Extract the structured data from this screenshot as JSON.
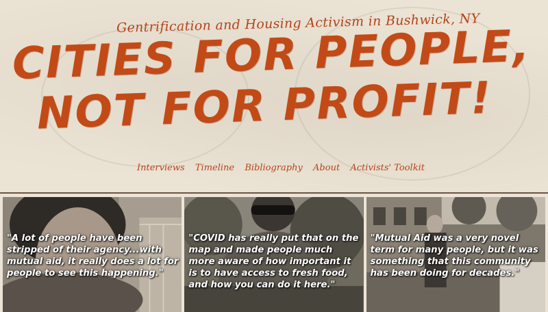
{
  "site": {
    "subtitle": "Gentrification and Housing Activism in Bushwick, NY",
    "headline_line1": "CITIES FOR PEOPLE,",
    "headline_line2": "NOT FOR PROFIT!"
  },
  "nav": {
    "items": [
      {
        "label": "Interviews"
      },
      {
        "label": "Timeline"
      },
      {
        "label": "Bibliography"
      },
      {
        "label": "About"
      },
      {
        "label": "Activists' Toolkit"
      }
    ]
  },
  "quotes": [
    {
      "text": "\"A lot of people have been stripped of their agency...with mutual aid, it really does a lot for people to see this happening.\""
    },
    {
      "text": "\"COVID has really put that on the map and made people much more aware of how important it is to have access to fresh food, and how you can do it here.\""
    },
    {
      "text": "\"Mutual Aid was a very novel term for many people, but it was something that this community has been doing for decades.\""
    }
  ],
  "colors": {
    "accent": "#c24a17",
    "paper": "#ebe3d4",
    "rule": "#6b5446"
  }
}
